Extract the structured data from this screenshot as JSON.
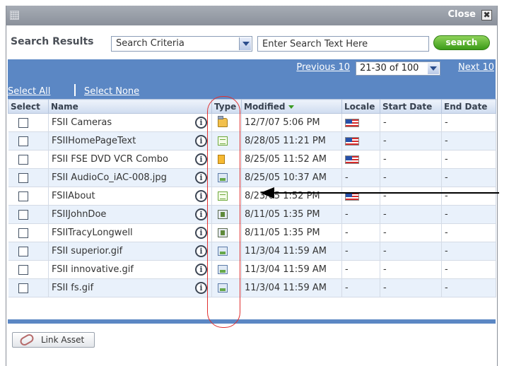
{
  "window": {
    "close_label": "Close",
    "close_glyph": "✖"
  },
  "search": {
    "title": "Search Results",
    "criteria_value": "Search Criteria",
    "text_placeholder": "Enter Search Text Here",
    "button_label": "search"
  },
  "pager": {
    "previous": "Previous 10",
    "range": "21-30 of 100",
    "next": "Next 10"
  },
  "selection": {
    "select_all": "Select All",
    "select_none": "Select None"
  },
  "columns": {
    "select": "Select",
    "name": "Name",
    "type": "Type",
    "modified": "Modified",
    "locale": "Locale",
    "start_date": "Start Date",
    "end_date": "End Date"
  },
  "rows": [
    {
      "name": "FSII Cameras",
      "type_icon": "folder-icon",
      "modified": "12/7/07 5:06 PM",
      "locale": "us-flag-icon",
      "start": "-",
      "end": "-"
    },
    {
      "name": "FSIIHomePageText",
      "type_icon": "page-icon",
      "modified": "8/28/05 11:21 PM",
      "locale": "us-flag-icon",
      "start": "-",
      "end": "-"
    },
    {
      "name": "FSII FSE DVD VCR Combo",
      "type_icon": "product-icon",
      "modified": "8/25/05 11:52 AM",
      "locale": "us-flag-icon",
      "start": "-",
      "end": "-"
    },
    {
      "name": "FSII AudioCo_iAC-008.jpg",
      "type_icon": "image-icon",
      "modified": "8/25/05 10:37 AM",
      "locale": "-",
      "start": "-",
      "end": "-"
    },
    {
      "name": "FSIIAbout",
      "type_icon": "page-icon",
      "modified": "8/23/05 1:52 PM",
      "locale": "us-flag-icon",
      "start": "-",
      "end": "-"
    },
    {
      "name": "FSIIJohnDoe",
      "type_icon": "person-icon",
      "modified": "8/11/05 1:35 PM",
      "locale": "-",
      "start": "-",
      "end": "-"
    },
    {
      "name": "FSIITracyLongwell",
      "type_icon": "person-icon",
      "modified": "8/11/05 1:35 PM",
      "locale": "-",
      "start": "-",
      "end": "-"
    },
    {
      "name": "FSII superior.gif",
      "type_icon": "image-icon",
      "modified": "11/3/04 11:59 AM",
      "locale": "-",
      "start": "-",
      "end": "-"
    },
    {
      "name": "FSII innovative.gif",
      "type_icon": "image-icon",
      "modified": "11/3/04 11:59 AM",
      "locale": "-",
      "start": "-",
      "end": "-"
    },
    {
      "name": "FSII fs.gif",
      "type_icon": "image-icon",
      "modified": "11/3/04 11:59 AM",
      "locale": "-",
      "start": "-",
      "end": "-"
    }
  ],
  "footer": {
    "link_asset": "Link Asset"
  },
  "colors": {
    "accent_bar": "#5b87c4",
    "search_green": "#3b9a18",
    "annotation_red": "#e03030"
  }
}
